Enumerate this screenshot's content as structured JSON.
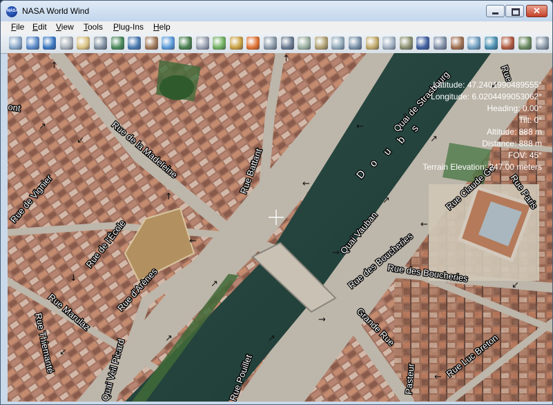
{
  "window": {
    "title": "NASA World Wind",
    "app_icon_text": "NASA"
  },
  "menu": [
    "File",
    "Edit",
    "View",
    "Tools",
    "Plug-Ins",
    "Help"
  ],
  "toolbar": {
    "icons": [
      "star-icon",
      "compass-cross-icon",
      "globe-grid-icon",
      "clock-icon",
      "home-icon",
      "zoom-icon",
      "planet-icon",
      "earth-icon",
      "landsat-icon",
      "globe-icon",
      "earth-small-icon",
      "cloud-icon",
      "map-icon",
      "palette-icon",
      "rainbow-icon",
      "layer-icon",
      "grid-icon",
      "photo-icon",
      "tile-icon",
      "image-icon",
      "image2-icon",
      "lat-long-icon",
      "scale-icon",
      "ruler-icon",
      "search-icon",
      "measure-icon",
      "tools-icon",
      "flag-icon",
      "globe-net-icon",
      "wms-icon",
      "terrain-icon",
      "settings-icon"
    ],
    "colors": [
      "#8aa8c8",
      "#5a8ac8",
      "#3a78c0",
      "#a8b0b8",
      "#d8c080",
      "#8090a0",
      "#4a8a5a",
      "#4a7ab0",
      "#a07858",
      "#5a9ad8",
      "#4a8050",
      "#9aa0b0",
      "#70b060",
      "#c8a040",
      "#e07030",
      "#8a9aa8",
      "#6a7a90",
      "#9ab0a0",
      "#b0a070",
      "#90a8b8",
      "#7890a8",
      "#c0a868",
      "#a0b0c0",
      "#8a9070",
      "#4060a0",
      "#8090a8",
      "#a07050",
      "#70a0c0",
      "#4a90b0",
      "#b05a40",
      "#6a8a60",
      "#8a9aa8"
    ]
  },
  "hud": {
    "latitude": "Latitude: 47.2401990489555°",
    "longitude": "Longitude: 6.0204499053062°",
    "heading": "Heading: 0.00°",
    "tilt": "Tilt: 0°",
    "altitude": "Altitude: 888 m",
    "distance": "Distance: 888 m",
    "fov": "FOV: 45°",
    "terrain_elevation": "Terrain Elevation: 247.00 meters"
  },
  "streets": [
    "Quai de Strasbourg",
    "Rue de la Madeleine",
    "Rue Battant",
    "Rue de Vignier",
    "Rue de l'École",
    "Rue d'Arènes",
    "Quai Vauban",
    "Rue des Boucheries",
    "Rue des Boucheries",
    "Rue Claude Go",
    "Rue Paris",
    "Rue Marulaz",
    "Rue Thiemanté",
    "Quai Veil Picard",
    "Grande Rue",
    "Rue Luc Breton",
    "Rue Pouillet",
    "Pasteur",
    "ont",
    "Rue"
  ],
  "river": {
    "name": "Doubs",
    "letters": [
      "D",
      "o",
      "u",
      "b",
      "s"
    ]
  },
  "colors": {
    "water": "#23433d",
    "rooftops": "#a06a52",
    "stone": "#b8b2a6",
    "green": "#3f6a38"
  }
}
